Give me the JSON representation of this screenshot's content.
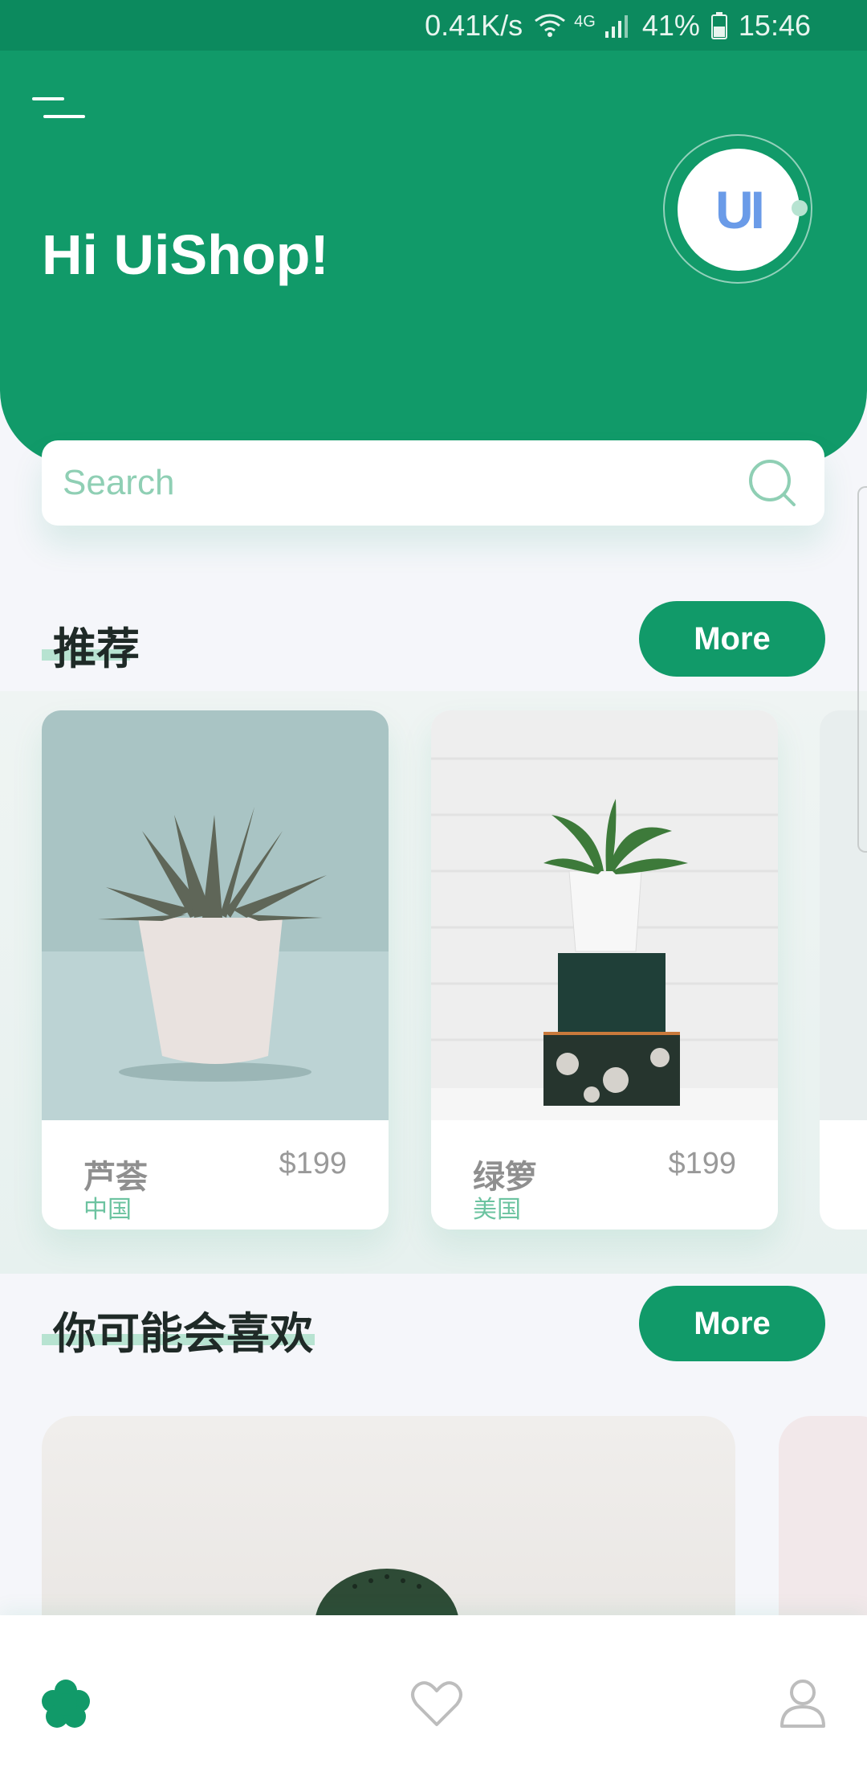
{
  "status_bar": {
    "speed": "0.41K/s",
    "network": "4G",
    "battery": "41%",
    "time": "15:46"
  },
  "header": {
    "greeting": "Hi UiShop!",
    "avatar_text": "UI"
  },
  "search": {
    "placeholder": "Search"
  },
  "recommend": {
    "title": "推荐",
    "more_label": "More",
    "items": [
      {
        "name": "芦荟",
        "origin": "中国",
        "price": "$199"
      },
      {
        "name": "绿箩",
        "origin": "美国",
        "price": "$199"
      }
    ]
  },
  "like": {
    "title": "你可能会喜欢",
    "more_label": "More"
  },
  "bottom_nav": {
    "items": [
      {
        "icon": "flower-icon",
        "active": true
      },
      {
        "icon": "heart-icon",
        "active": false
      },
      {
        "icon": "user-icon",
        "active": false
      }
    ]
  },
  "colors": {
    "primary": "#119a69",
    "status_bar": "#0c8a5e",
    "background": "#f5f6fa",
    "accent_light": "#b7e3d1",
    "origin_text": "#6cc3a0"
  }
}
